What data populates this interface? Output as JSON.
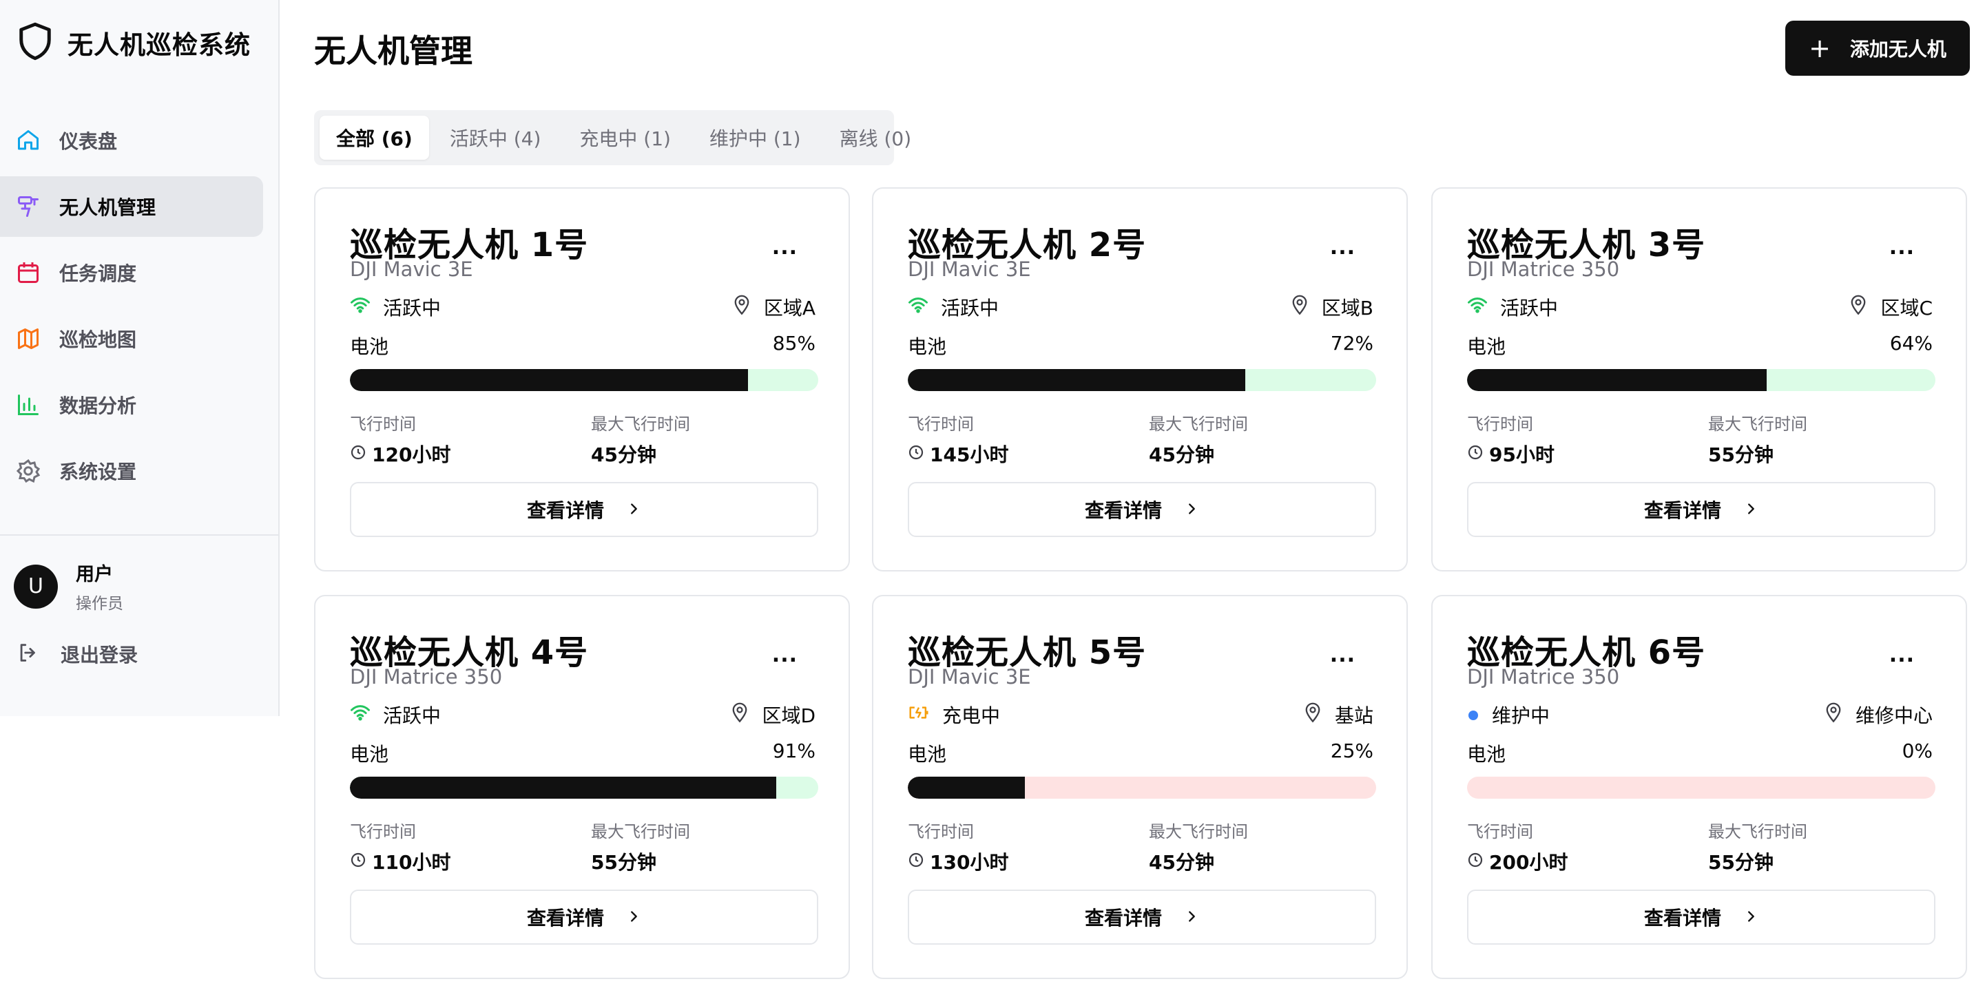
{
  "app": {
    "title": "无人机巡检系统"
  },
  "sidebar": {
    "items": [
      {
        "label": "仪表盘",
        "icon": "home-icon",
        "color": "#0ea5e9"
      },
      {
        "label": "无人机管理",
        "icon": "drone-icon",
        "color": "#8b5cf6",
        "active": true
      },
      {
        "label": "任务调度",
        "icon": "calendar-icon",
        "color": "#e11d48"
      },
      {
        "label": "巡检地图",
        "icon": "map-icon",
        "color": "#f97316"
      },
      {
        "label": "数据分析",
        "icon": "bar-chart-icon",
        "color": "#22c55e"
      },
      {
        "label": "系统设置",
        "icon": "gear-icon",
        "color": "#71717a"
      }
    ],
    "user": {
      "avatar": "U",
      "name": "用户",
      "role": "操作员"
    },
    "logout": {
      "label": "退出登录",
      "icon": "logout-icon"
    }
  },
  "header": {
    "title": "无人机管理",
    "add_button": {
      "plus": "+",
      "label": "添加无人机"
    }
  },
  "tabs": [
    {
      "label": "全部 (6)",
      "active": true
    },
    {
      "label": "活跃中 (4)"
    },
    {
      "label": "充电中 (1)"
    },
    {
      "label": "维护中 (1)"
    },
    {
      "label": "离线 (0)"
    }
  ],
  "labels": {
    "battery": "电池",
    "flight_time": "飞行时间",
    "max_flight_time": "最大飞行时间",
    "details": "查看详情",
    "more": "..."
  },
  "drones": [
    {
      "name": "巡检无人机 1号",
      "model": "DJI Mavic 3E",
      "status": "活跃中",
      "status_type": "active",
      "location": "区域A",
      "battery": 85,
      "battery_label": "85%",
      "flight_time": "120小时",
      "max_flight": "45分钟"
    },
    {
      "name": "巡检无人机 2号",
      "model": "DJI Mavic 3E",
      "status": "活跃中",
      "status_type": "active",
      "location": "区域B",
      "battery": 72,
      "battery_label": "72%",
      "flight_time": "145小时",
      "max_flight": "45分钟"
    },
    {
      "name": "巡检无人机 3号",
      "model": "DJI Matrice 350",
      "status": "活跃中",
      "status_type": "active",
      "location": "区域C",
      "battery": 64,
      "battery_label": "64%",
      "flight_time": "95小时",
      "max_flight": "55分钟"
    },
    {
      "name": "巡检无人机 4号",
      "model": "DJI Matrice 350",
      "status": "活跃中",
      "status_type": "active",
      "location": "区域D",
      "battery": 91,
      "battery_label": "91%",
      "flight_time": "110小时",
      "max_flight": "55分钟"
    },
    {
      "name": "巡检无人机 5号",
      "model": "DJI Mavic 3E",
      "status": "充电中",
      "status_type": "charging",
      "location": "基站",
      "battery": 25,
      "battery_label": "25%",
      "flight_time": "130小时",
      "max_flight": "45分钟"
    },
    {
      "name": "巡检无人机 6号",
      "model": "DJI Matrice 350",
      "status": "维护中",
      "status_type": "maintenance",
      "location": "维修中心",
      "battery": 0,
      "battery_label": "0%",
      "flight_time": "200小时",
      "max_flight": "55分钟"
    }
  ],
  "colors": {
    "active": "#22c55e",
    "charging": "#f59e0b",
    "maintenance": "#3b82f6",
    "primary": "#111111"
  }
}
